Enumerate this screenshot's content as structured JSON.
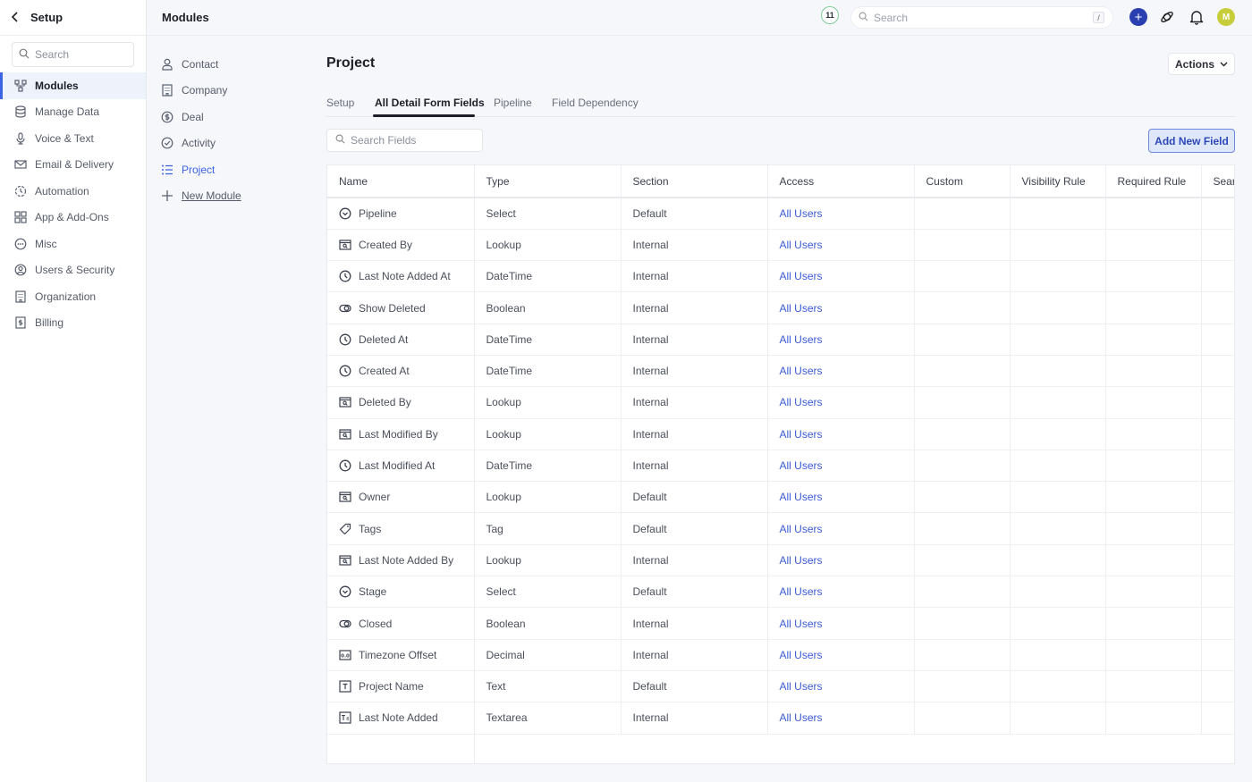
{
  "sidebar": {
    "back_label": "<",
    "title": "Setup",
    "search_placeholder": "Search",
    "items": [
      {
        "label": "Modules",
        "icon": "modules-icon",
        "active": true
      },
      {
        "label": "Manage Data",
        "icon": "database-icon"
      },
      {
        "label": "Voice & Text",
        "icon": "microphone-icon"
      },
      {
        "label": "Email & Delivery",
        "icon": "mail-icon"
      },
      {
        "label": "Automation",
        "icon": "automation-icon"
      },
      {
        "label": "App & Add-Ons",
        "icon": "apps-grid-icon"
      },
      {
        "label": "Misc",
        "icon": "more-circle-icon"
      },
      {
        "label": "Users & Security",
        "icon": "user-circle-icon"
      },
      {
        "label": "Organization",
        "icon": "building-icon"
      },
      {
        "label": "Billing",
        "icon": "billing-icon"
      }
    ]
  },
  "topbar": {
    "section_title": "Modules",
    "count_badge": "11",
    "search_placeholder": "Search",
    "search_shortcut": "/",
    "avatar_initial": "M",
    "avatar_color": "#c6cc3a",
    "plus_color": "#2a3fb0"
  },
  "modules": {
    "items": [
      {
        "label": "Contact",
        "icon": "person-icon"
      },
      {
        "label": "Company",
        "icon": "building-icon"
      },
      {
        "label": "Deal",
        "icon": "dollar-icon"
      },
      {
        "label": "Activity",
        "icon": "check-circle-icon"
      },
      {
        "label": "Project",
        "icon": "list-icon",
        "active": true
      },
      {
        "label": "New Module",
        "icon": "plus-icon"
      }
    ]
  },
  "main": {
    "title": "Project",
    "actions_label": "Actions",
    "tabs": [
      {
        "label": "Setup"
      },
      {
        "label": "All Detail Form Fields",
        "active": true
      },
      {
        "label": "Pipeline"
      },
      {
        "label": "Field Dependency"
      }
    ],
    "search_fields_placeholder": "Search Fields",
    "add_field_label": "Add New Field",
    "accent_color": "#3b5bd6"
  },
  "table": {
    "columns": [
      "Name",
      "Type",
      "Section",
      "Access",
      "Custom",
      "Visibility Rule",
      "Required Rule",
      "Searchable"
    ],
    "rows": [
      {
        "name": "Pipeline",
        "icon": "select-icon",
        "type": "Select",
        "section": "Default",
        "access": "All Users"
      },
      {
        "name": "Created By",
        "icon": "lookup-icon",
        "type": "Lookup",
        "section": "Internal",
        "access": "All Users"
      },
      {
        "name": "Last Note Added At",
        "icon": "clock-icon",
        "type": "DateTime",
        "section": "Internal",
        "access": "All Users"
      },
      {
        "name": "Show Deleted",
        "icon": "toggle-icon",
        "type": "Boolean",
        "section": "Internal",
        "access": "All Users"
      },
      {
        "name": "Deleted At",
        "icon": "clock-icon",
        "type": "DateTime",
        "section": "Internal",
        "access": "All Users"
      },
      {
        "name": "Created At",
        "icon": "clock-icon",
        "type": "DateTime",
        "section": "Internal",
        "access": "All Users"
      },
      {
        "name": "Deleted By",
        "icon": "lookup-icon",
        "type": "Lookup",
        "section": "Internal",
        "access": "All Users"
      },
      {
        "name": "Last Modified By",
        "icon": "lookup-icon",
        "type": "Lookup",
        "section": "Internal",
        "access": "All Users"
      },
      {
        "name": "Last Modified At",
        "icon": "clock-icon",
        "type": "DateTime",
        "section": "Internal",
        "access": "All Users"
      },
      {
        "name": "Owner",
        "icon": "lookup-icon",
        "type": "Lookup",
        "section": "Default",
        "access": "All Users"
      },
      {
        "name": "Tags",
        "icon": "tag-icon",
        "type": "Tag",
        "section": "Default",
        "access": "All Users"
      },
      {
        "name": "Last Note Added By",
        "icon": "lookup-icon",
        "type": "Lookup",
        "section": "Internal",
        "access": "All Users"
      },
      {
        "name": "Stage",
        "icon": "select-icon",
        "type": "Select",
        "section": "Default",
        "access": "All Users"
      },
      {
        "name": "Closed",
        "icon": "toggle-icon",
        "type": "Boolean",
        "section": "Internal",
        "access": "All Users"
      },
      {
        "name": "Timezone Offset",
        "icon": "decimal-icon",
        "type": "Decimal",
        "section": "Internal",
        "access": "All Users"
      },
      {
        "name": "Project Name",
        "icon": "text-icon",
        "type": "Text",
        "section": "Default",
        "access": "All Users"
      },
      {
        "name": "Last Note Added",
        "icon": "textarea-icon",
        "type": "Textarea",
        "section": "Internal",
        "access": "All Users"
      }
    ]
  }
}
